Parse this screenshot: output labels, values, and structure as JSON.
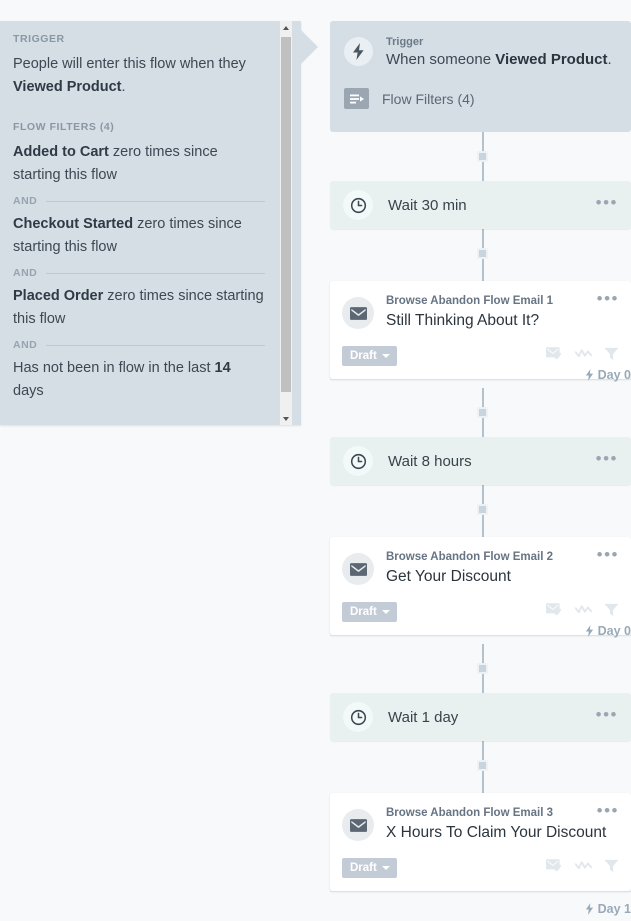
{
  "tooltip": {
    "trigger_kicker": "TRIGGER",
    "trigger_line_1": "People will enter this flow when they",
    "trigger_metric": "Viewed Product",
    "trigger_period": ".",
    "filters_kicker": "FLOW FILTERS (4)",
    "and_label": "AND",
    "filters": [
      {
        "metric": "Added to Cart",
        "rest": " zero times since starting this flow"
      },
      {
        "metric": "Checkout Started",
        "rest": " zero times since starting this flow"
      },
      {
        "metric": "Placed Order",
        "rest": " zero times since starting this flow"
      },
      {
        "prefix": "Has not been in flow in the last ",
        "metric": "14",
        "rest": " days"
      }
    ]
  },
  "flow": {
    "trigger": {
      "label": "Trigger",
      "text_before": "When someone ",
      "event": "Viewed Product",
      "text_after": ".",
      "filters_label": "Flow Filters (4)",
      "icon": "lightning-bolt-icon",
      "filters_icon": "flow-filter-icon"
    },
    "nodes": [
      {
        "type": "wait",
        "name": "wait-30-min",
        "label": "Wait 30 min",
        "icon": "clock-icon",
        "menu": "•••"
      },
      {
        "type": "email",
        "name": "browse-abandon-email-1",
        "title": "Browse Abandon Flow Email 1",
        "subject": "Still Thinking About It?",
        "status": "Draft",
        "icon": "envelope-icon",
        "menu": "•••",
        "day_label": "Day 0"
      },
      {
        "type": "wait",
        "name": "wait-8-hours",
        "label": "Wait 8 hours",
        "icon": "clock-icon",
        "menu": "•••"
      },
      {
        "type": "email",
        "name": "browse-abandon-email-2",
        "title": "Browse Abandon Flow Email 2",
        "subject": "Get Your Discount",
        "status": "Draft",
        "icon": "envelope-icon",
        "menu": "•••",
        "day_label": "Day 0"
      },
      {
        "type": "wait",
        "name": "wait-1-day",
        "label": "Wait 1 day",
        "icon": "clock-icon",
        "menu": "•••"
      },
      {
        "type": "email",
        "name": "browse-abandon-email-3",
        "title": "Browse Abandon Flow Email 3",
        "subject": "X Hours To Claim Your Discount",
        "status": "Draft",
        "icon": "envelope-icon",
        "menu": "•••",
        "day_label": "Day 1"
      }
    ],
    "card_icons": [
      "email-check-icon",
      "analytics-icon",
      "filter-funnel-icon"
    ]
  },
  "colors": {
    "panel_bg": "#d5dde5",
    "wait_card_bg": "#e8f0f0",
    "email_card_bg": "#ffffff",
    "canvas_bg": "#f7f9fa",
    "draft_badge": "#c3ccd6",
    "connector": "#b4c2cd"
  }
}
